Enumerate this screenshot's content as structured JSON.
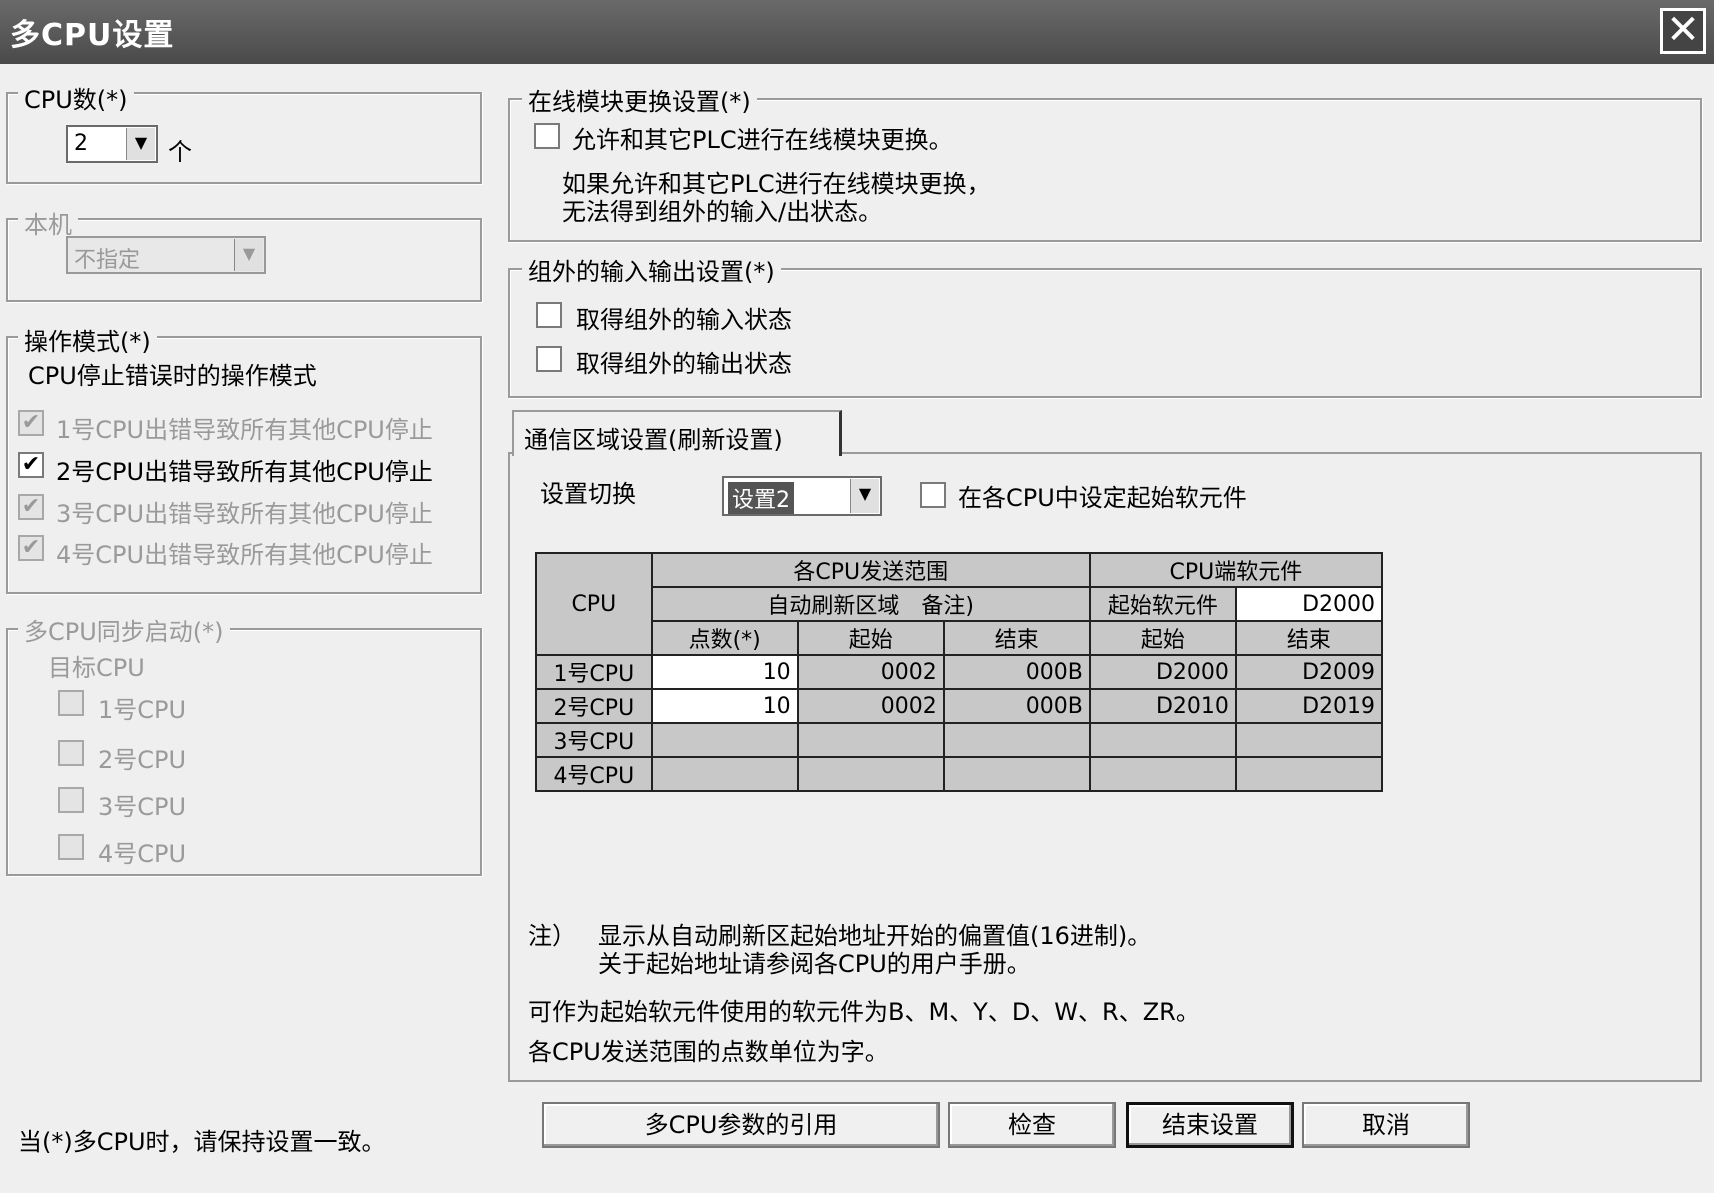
{
  "window": {
    "title": "多CPU设置",
    "close_glyph": "✕"
  },
  "cpu_count": {
    "legend": "CPU数(*)",
    "value": "2",
    "unit": "个"
  },
  "host": {
    "legend": "本机",
    "value": "不指定"
  },
  "op_mode": {
    "legend": "操作模式(*)",
    "subtitle": "CPU停止错误时的操作模式",
    "items": [
      {
        "label": "1号CPU出错导致所有其他CPU停止",
        "checked": true,
        "enabled": false
      },
      {
        "label": "2号CPU出错导致所有其他CPU停止",
        "checked": true,
        "enabled": true
      },
      {
        "label": "3号CPU出错导致所有其他CPU停止",
        "checked": true,
        "enabled": false
      },
      {
        "label": "4号CPU出错导致所有其他CPU停止",
        "checked": true,
        "enabled": false
      }
    ]
  },
  "sync_start": {
    "legend": "多CPU同步启动(*)",
    "target_label": "目标CPU",
    "items": [
      "1号CPU",
      "2号CPU",
      "3号CPU",
      "4号CPU"
    ]
  },
  "online_module": {
    "legend": "在线模块更换设置(*)",
    "checkbox_label": "允许和其它PLC进行在线模块更换。",
    "note_line1": "如果允许和其它PLC进行在线模块更换，",
    "note_line2": "无法得到组外的输入/出状态。"
  },
  "outside_io": {
    "legend": "组外的输入输出设置(*)",
    "input_label": "取得组外的输入状态",
    "output_label": "取得组外的输出状态"
  },
  "comm": {
    "tab_label": "通信区域设置(刷新设置)",
    "switch_label": "设置切换",
    "switch_value": "设置2",
    "start_device_checkbox": "在各CPU中设定起始软元件"
  },
  "table": {
    "h_cpu": "CPU",
    "h_send_range": "各CPU发送范围",
    "h_cpu_device": "CPU端软元件",
    "h_auto_refresh": "自动刷新区域　备注)",
    "h_start_device": "起始软元件",
    "start_device_value": "D2000",
    "h_points": "点数(*)",
    "h_start": "起始",
    "h_end": "结束",
    "h_dev_start": "起始",
    "h_dev_end": "结束",
    "rows": [
      {
        "cpu": "1号CPU",
        "points": "10",
        "start": "0002",
        "end": "000B",
        "dev_start": "D2000",
        "dev_end": "D2009"
      },
      {
        "cpu": "2号CPU",
        "points": "10",
        "start": "0002",
        "end": "000B",
        "dev_start": "D2010",
        "dev_end": "D2019"
      },
      {
        "cpu": "3号CPU",
        "points": "",
        "start": "",
        "end": "",
        "dev_start": "",
        "dev_end": ""
      },
      {
        "cpu": "4号CPU",
        "points": "",
        "start": "",
        "end": "",
        "dev_start": "",
        "dev_end": ""
      }
    ]
  },
  "notes": {
    "prefix": "注）",
    "line1": "显示从自动刷新区起始地址开始的偏置值(16进制)。",
    "line2": "关于起始地址请参阅各CPU的用户手册。",
    "line3": "可作为起始软元件使用的软元件为B、M、Y、D、W、R、ZR。",
    "line4": "各CPU发送范围的点数单位为字。"
  },
  "footer": {
    "hint": "当(*)多CPU时，请保持设置一致。",
    "btn_import": "多CPU参数的引用",
    "btn_check": "检查",
    "btn_finish": "结束设置",
    "btn_cancel": "取消"
  }
}
